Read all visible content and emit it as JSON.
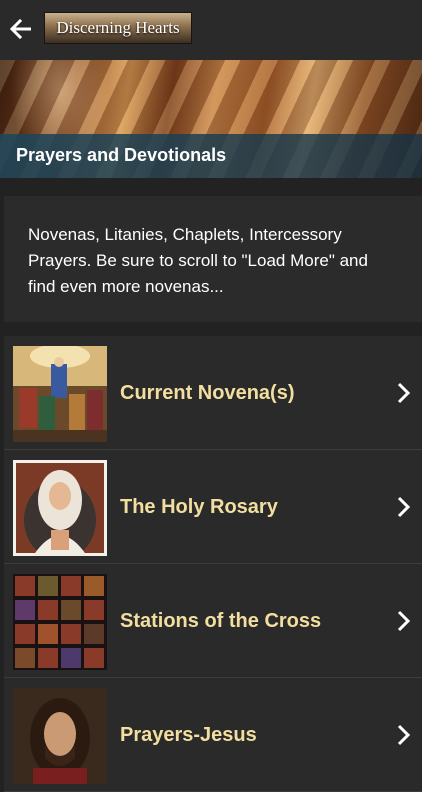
{
  "header": {
    "back_icon": "arrow-left-icon",
    "logo_text": "Discerning Hearts"
  },
  "banner": {
    "title": "Prayers and Devotionals"
  },
  "description": {
    "text": "Novenas, Litanies, Chaplets, Intercessory Prayers.  Be sure to scroll to \"Load More\" and find even more novenas..."
  },
  "list": {
    "items": [
      {
        "label": "Current Novena(s)",
        "thumb": "pentecost-painting"
      },
      {
        "label": "The Holy Rosary",
        "thumb": "madonna-portrait"
      },
      {
        "label": "Stations of the Cross",
        "thumb": "stations-grid"
      },
      {
        "label": "Prayers-Jesus",
        "thumb": "jesus-portrait"
      }
    ],
    "chevron_icon": "chevron-right-icon"
  },
  "colors": {
    "background": "#222222",
    "row_background": "#2a2a2a",
    "row_label": "#f2dfa0",
    "caption_bar": "#1e465a"
  }
}
